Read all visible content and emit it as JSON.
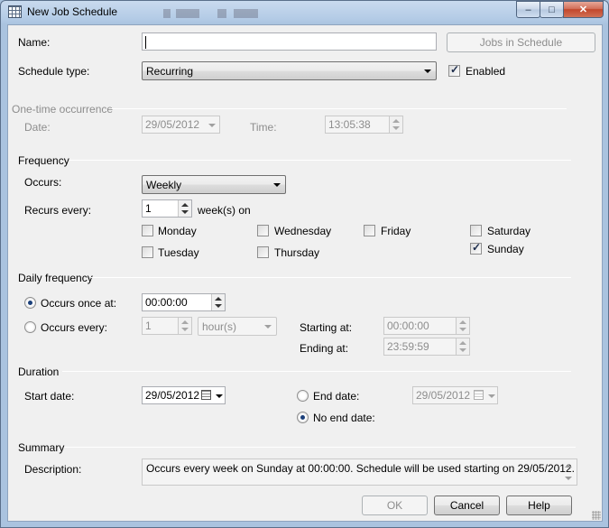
{
  "window": {
    "title": "New Job Schedule",
    "caption_buttons": {
      "minimize": "‒",
      "maximize": "□",
      "close": "✕"
    }
  },
  "general": {
    "name_label": "Name:",
    "name_value": "",
    "jobs_button": "Jobs in Schedule",
    "schedule_type_label": "Schedule type:",
    "schedule_type_value": "Recurring",
    "enabled_label": "Enabled",
    "enabled_checked": true
  },
  "one_time": {
    "section_label": "One-time occurrence",
    "date_label": "Date:",
    "date_value": "29/05/2012",
    "time_label": "Time:",
    "time_value": "13:05:38"
  },
  "frequency": {
    "section_label": "Frequency",
    "occurs_label": "Occurs:",
    "occurs_value": "Weekly",
    "recurs_label": "Recurs every:",
    "recurs_value": "1",
    "recurs_unit": "week(s) on",
    "days": [
      {
        "label": "Monday",
        "checked": false
      },
      {
        "label": "Wednesday",
        "checked": false
      },
      {
        "label": "Friday",
        "checked": false
      },
      {
        "label": "Saturday",
        "checked": false
      },
      {
        "label": "Tuesday",
        "checked": false
      },
      {
        "label": "Thursday",
        "checked": false
      },
      {
        "label": "Sunday",
        "checked": true
      }
    ]
  },
  "daily": {
    "section_label": "Daily frequency",
    "once_label": "Occurs once at:",
    "once_value": "00:00:00",
    "every_label": "Occurs every:",
    "every_value": "1",
    "every_unit": "hour(s)",
    "starting_label": "Starting at:",
    "starting_value": "00:00:00",
    "ending_label": "Ending at:",
    "ending_value": "23:59:59",
    "selected": "once"
  },
  "duration": {
    "section_label": "Duration",
    "start_label": "Start date:",
    "start_value": "29/05/2012",
    "end_label": "End date:",
    "end_value": "29/05/2012",
    "no_end_label": "No end date:",
    "selected": "no_end"
  },
  "summary": {
    "section_label": "Summary",
    "description_label": "Description:",
    "description_value": "Occurs every week on Sunday at 00:00:00. Schedule will be used starting on 29/05/2012."
  },
  "buttons": {
    "ok": "OK",
    "cancel": "Cancel",
    "help": "Help"
  }
}
